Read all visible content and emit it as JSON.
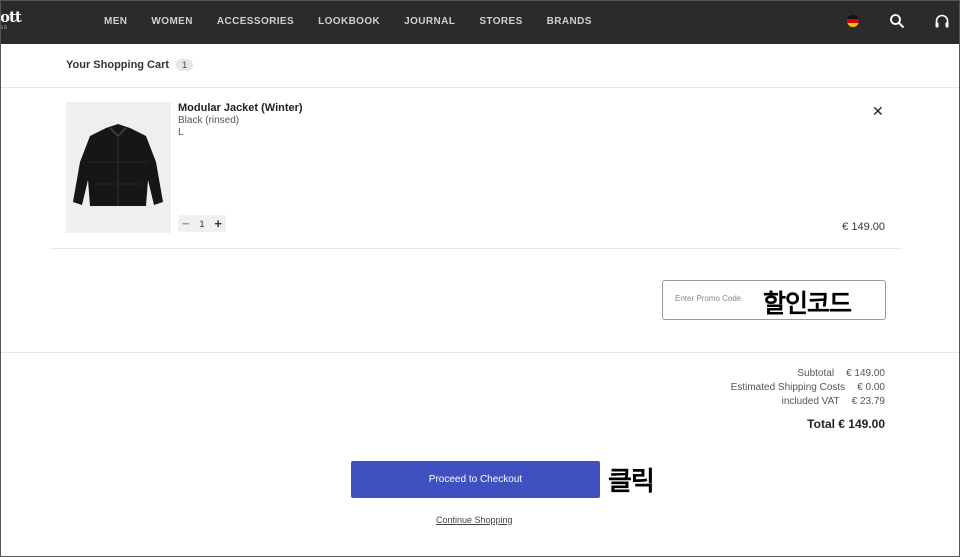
{
  "header": {
    "logo_text": "ott",
    "logo_sub": "ss",
    "nav": [
      "MEN",
      "WOMEN",
      "ACCESSORIES",
      "LOOKBOOK",
      "JOURNAL",
      "STORES",
      "BRANDS"
    ],
    "icons": [
      "germany-flag-icon",
      "search-icon",
      "headphones-icon"
    ]
  },
  "cart": {
    "title": "Your Shopping Cart",
    "count": "1",
    "item": {
      "name": "Modular Jacket (Winter)",
      "color": "Black (rinsed)",
      "size": "L",
      "quantity": "1",
      "price": "€ 149.00",
      "image": "black-jacket-image"
    }
  },
  "promo": {
    "placeholder": "Enter Promo Code",
    "annotation": "할인코드"
  },
  "totals": {
    "subtotal_label": "Subtotal",
    "subtotal_value": "€ 149.00",
    "shipping_label": "Estimated Shipping Costs",
    "shipping_value": "€ 0.00",
    "vat_label": "included VAT",
    "vat_value": "€ 23.79",
    "total": "Total € 149.00"
  },
  "actions": {
    "checkout_label": "Proceed to Checkout",
    "checkout_annotation": "클릭",
    "continue_label": "Continue Shopping"
  },
  "colors": {
    "topbar": "#2b2b2b",
    "checkout": "#3f51c0"
  }
}
